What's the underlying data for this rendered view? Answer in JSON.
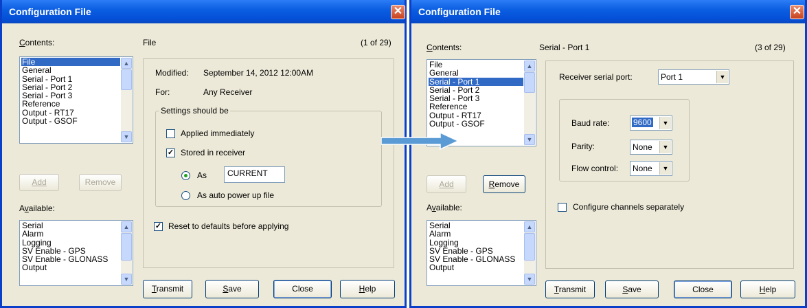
{
  "left": {
    "title": "Configuration File",
    "close_glyph": "✕",
    "contents_label": "Contents:",
    "contents_items": [
      "File",
      "General",
      "Serial - Port 1",
      "Serial - Port 2",
      "Serial - Port 3",
      "Reference",
      "Output - RT17",
      "Output - GSOF"
    ],
    "selected_index": 0,
    "page_name": "File",
    "page_counter": "(1 of 29)",
    "add_label": "Add",
    "remove_label": "Remove",
    "available_label": "Available:",
    "available_items": [
      "Serial",
      "Alarm",
      "Logging",
      "SV Enable - GPS",
      "SV Enable - GLONASS",
      "Output"
    ],
    "modified_label": "Modified:",
    "modified_value": "September 14, 2012 12:00AM",
    "for_label": "For:",
    "for_value": "Any Receiver",
    "settings_group": "Settings should be",
    "applied_label": "Applied immediately",
    "applied_checked": false,
    "stored_label": "Stored in receiver",
    "stored_checked": true,
    "as_label": "As",
    "as_value": "CURRENT",
    "auto_power_label": "As auto power up file",
    "reset_label": "Reset to defaults before applying",
    "reset_checked": true,
    "transmit_label": "Transmit",
    "save_label": "Save",
    "close_label": "Close",
    "help_label": "Help"
  },
  "right": {
    "title": "Configuration File",
    "close_glyph": "✕",
    "contents_label": "Contents:",
    "contents_items": [
      "File",
      "General",
      "Serial - Port 1",
      "Serial - Port 2",
      "Serial - Port 3",
      "Reference",
      "Output - RT17",
      "Output - GSOF"
    ],
    "selected_index": 2,
    "page_name": "Serial - Port 1",
    "page_counter": "(3 of 29)",
    "add_label": "Add",
    "remove_label": "Remove",
    "available_label": "Available:",
    "available_items": [
      "Serial",
      "Alarm",
      "Logging",
      "SV Enable - GPS",
      "SV Enable - GLONASS",
      "Output"
    ],
    "receiver_port_label": "Receiver serial port:",
    "receiver_port_value": "Port 1",
    "baud_label": "Baud rate:",
    "baud_value": "9600",
    "parity_label": "Parity:",
    "parity_value": "None",
    "flow_label": "Flow control:",
    "flow_value": "None",
    "configure_label": "Configure channels separately",
    "configure_checked": false,
    "transmit_label": "Transmit",
    "save_label": "Save",
    "close_label": "Close",
    "help_label": "Help"
  },
  "colors": {
    "title_bar": "#0a5ce0",
    "selection": "#316ac5",
    "arrow": "#5b9bd5"
  }
}
